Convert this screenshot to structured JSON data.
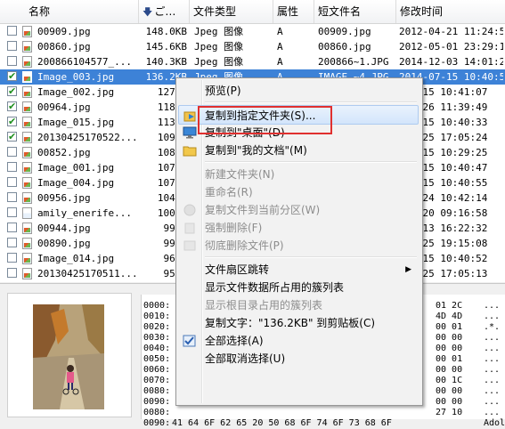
{
  "header": {
    "name": "名称",
    "size": "ご…",
    "type": "文件类型",
    "attr": "属性",
    "short": "短文件名",
    "mtime": "修改时间"
  },
  "files": [
    {
      "checked": false,
      "icon": "image-file",
      "name": "00909.jpg",
      "size": "148.0KB",
      "type": "Jpeg 图像",
      "attr": "A",
      "short": "00909.jpg",
      "mtime": "2012-04-21 11:24:58",
      "selected": false
    },
    {
      "checked": false,
      "icon": "image-file",
      "name": "00860.jpg",
      "size": "145.6KB",
      "type": "Jpeg 图像",
      "attr": "A",
      "short": "00860.jpg",
      "mtime": "2012-05-01 23:29:18",
      "selected": false
    },
    {
      "checked": false,
      "icon": "image-file",
      "name": "200866104577_...",
      "size": "140.3KB",
      "type": "Jpeg 图像",
      "attr": "A",
      "short": "200866~1.JPG",
      "mtime": "2014-12-03 14:01:25",
      "selected": false
    },
    {
      "checked": true,
      "icon": "image-file",
      "name": "Image_003.jpg",
      "size": "136.2KB",
      "type": "Jpeg 图像",
      "attr": "A",
      "short": "IMAGE_~4.JPG",
      "mtime": "2014-07-15 10:40:51",
      "selected": true
    },
    {
      "checked": true,
      "icon": "image-file",
      "name": "Image_002.jpg",
      "size": "127.3",
      "type": "",
      "attr": "",
      "short": "",
      "mtime": "-07-15 10:41:07",
      "selected": false
    },
    {
      "checked": true,
      "icon": "image-file",
      "name": "00964.jpg",
      "size": "118.4",
      "type": "",
      "attr": "",
      "short": "",
      "mtime": "-04-26 11:39:49",
      "selected": false
    },
    {
      "checked": true,
      "icon": "image-file",
      "name": "Image_015.jpg",
      "size": "113.9",
      "type": "",
      "attr": "",
      "short": "",
      "mtime": "-07-15 10:40:33",
      "selected": false
    },
    {
      "checked": true,
      "icon": "image-file",
      "name": "20130425170522...",
      "size": "109.1",
      "type": "",
      "attr": "",
      "short": "",
      "mtime": "-04-25 17:05:24",
      "selected": false
    },
    {
      "checked": false,
      "icon": "image-file",
      "name": "00852.jpg",
      "size": "108.6",
      "type": "",
      "attr": "",
      "short": "",
      "mtime": "-04-15 10:29:25",
      "selected": false
    },
    {
      "checked": false,
      "icon": "image-file",
      "name": "Image_001.jpg",
      "size": "107.7",
      "type": "",
      "attr": "",
      "short": "",
      "mtime": "-07-15 10:40:47",
      "selected": false
    },
    {
      "checked": false,
      "icon": "image-file",
      "name": "Image_004.jpg",
      "size": "107.7",
      "type": "",
      "attr": "",
      "short": "",
      "mtime": "-07-15 10:40:55",
      "selected": false
    },
    {
      "checked": false,
      "icon": "image-file",
      "name": "00956.jpg",
      "size": "104.8",
      "type": "",
      "attr": "",
      "short": "",
      "mtime": "-05-24 10:42:14",
      "selected": false
    },
    {
      "checked": false,
      "icon": "blank-file",
      "name": "amily_enerife...",
      "size": "100.4",
      "type": "",
      "attr": "",
      "short": "",
      "mtime": "-03-20 09:16:58",
      "selected": false
    },
    {
      "checked": false,
      "icon": "image-file",
      "name": "00944.jpg",
      "size": "99.5",
      "type": "",
      "attr": "",
      "short": "",
      "mtime": "-12-13 16:22:32",
      "selected": false
    },
    {
      "checked": false,
      "icon": "image-file",
      "name": "00890.jpg",
      "size": "99.0",
      "type": "",
      "attr": "",
      "short": "",
      "mtime": "-03-25 19:15:08",
      "selected": false
    },
    {
      "checked": false,
      "icon": "image-file",
      "name": "Image_014.jpg",
      "size": "96.2",
      "type": "",
      "attr": "",
      "short": "",
      "mtime": "-07-15 10:40:52",
      "selected": false
    },
    {
      "checked": false,
      "icon": "image-file",
      "name": "20130425170511...",
      "size": "95.3",
      "type": "",
      "attr": "",
      "short": "",
      "mtime": "-04-25 17:05:13",
      "selected": false
    }
  ],
  "hex": [
    {
      "offset": "0000:",
      "bytes": "",
      "right": "01 2C",
      "ascii": "..."
    },
    {
      "offset": "0010:",
      "bytes": "",
      "right": "4D 4D",
      "ascii": "..."
    },
    {
      "offset": "0020:",
      "bytes": "",
      "right": "00 01",
      "ascii": ".*."
    },
    {
      "offset": "0030:",
      "bytes": "",
      "right": "00 00",
      "ascii": "..."
    },
    {
      "offset": "0040:",
      "bytes": "",
      "right": "00 00",
      "ascii": "..."
    },
    {
      "offset": "0050:",
      "bytes": "",
      "right": "00 01",
      "ascii": "..."
    },
    {
      "offset": "0060:",
      "bytes": "",
      "right": "00 00",
      "ascii": "..."
    },
    {
      "offset": "0070:",
      "bytes": "",
      "right": "00 1C",
      "ascii": "..."
    },
    {
      "offset": "0080:",
      "bytes": "",
      "right": "00 00",
      "ascii": "..."
    },
    {
      "offset": "0090:",
      "bytes": "",
      "right": "00 00",
      "ascii": "..."
    },
    {
      "offset": "0080:",
      "bytes": "",
      "right": "27 10",
      "ascii": "..."
    },
    {
      "offset": "0090:",
      "bytes": "41 64 6F 62 65 20 50 68 6F 74 6F 73 68 6F",
      "right": "",
      "ascii": "Adol"
    }
  ],
  "menu": {
    "items": [
      {
        "kind": "item",
        "label": "预览(P)",
        "icon": "",
        "disabled": false
      },
      {
        "kind": "sep"
      },
      {
        "kind": "item",
        "label": "复制到指定文件夹(S)...",
        "icon": "copy-to-folder-icon",
        "disabled": false,
        "highlighted": true
      },
      {
        "kind": "item",
        "label": "复制到\"桌面\"(D)",
        "icon": "desktop-icon",
        "disabled": false
      },
      {
        "kind": "item",
        "label": "复制到\"我的文档\"(M)",
        "icon": "my-documents-icon",
        "disabled": false
      },
      {
        "kind": "sep"
      },
      {
        "kind": "item",
        "label": "新建文件夹(N)",
        "icon": "",
        "disabled": true
      },
      {
        "kind": "item",
        "label": "重命名(R)",
        "icon": "",
        "disabled": true
      },
      {
        "kind": "item",
        "label": "复制文件到当前分区(W)",
        "icon": "copy-partition-icon",
        "disabled": true
      },
      {
        "kind": "item",
        "label": "强制删除(F)",
        "icon": "force-delete-icon",
        "disabled": true
      },
      {
        "kind": "item",
        "label": "彻底删除文件(P)",
        "icon": "shred-icon",
        "disabled": true
      },
      {
        "kind": "sep"
      },
      {
        "kind": "item",
        "label": "文件扇区跳转",
        "icon": "",
        "disabled": false,
        "submenu": true
      },
      {
        "kind": "item",
        "label": "显示文件数据所占用的簇列表",
        "icon": "",
        "disabled": false
      },
      {
        "kind": "item",
        "label": "显示根目录占用的簇列表",
        "icon": "",
        "disabled": true
      },
      {
        "kind": "item",
        "label": "复制文字：\"136.2KB\" 到剪贴板(C)",
        "icon": "",
        "disabled": false
      },
      {
        "kind": "item",
        "label": "全部选择(A)",
        "icon": "select-all-icon",
        "disabled": false
      },
      {
        "kind": "item",
        "label": "全部取消选择(U)",
        "icon": "",
        "disabled": false
      }
    ]
  },
  "colors": {
    "selection": "#3d82d7",
    "highlight_box": "#e0302f"
  }
}
